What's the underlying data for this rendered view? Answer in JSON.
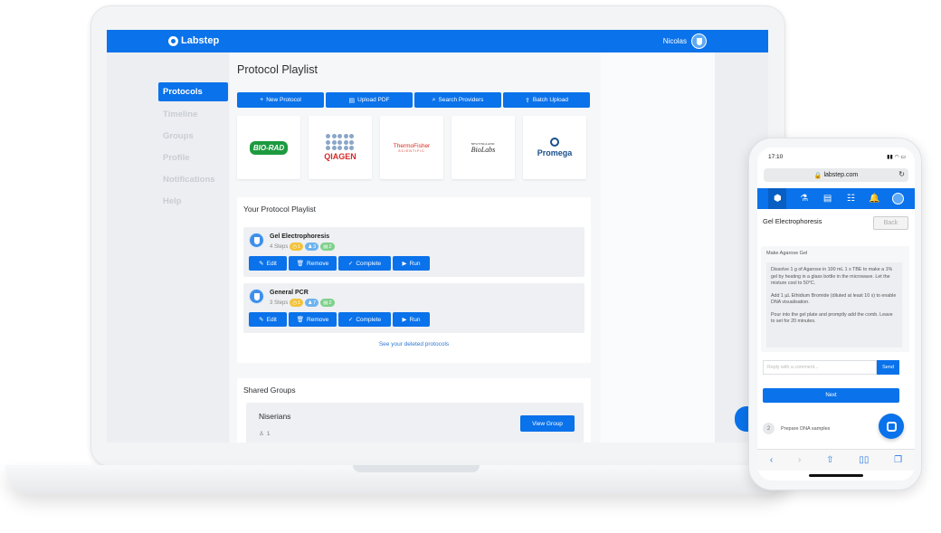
{
  "app": {
    "logo": "Labstep",
    "user_name": "Nicolas"
  },
  "sidebar": {
    "items": [
      {
        "label": "Protocols",
        "active": true
      },
      {
        "label": "Timeline"
      },
      {
        "label": "Groups"
      },
      {
        "label": "Profile"
      },
      {
        "label": "Notifications"
      },
      {
        "label": "Help"
      }
    ]
  },
  "main": {
    "title": "Protocol Playlist",
    "actions": [
      "New Protocol",
      "Upload PDF",
      "Search Providers",
      "Batch Upload"
    ],
    "providers": [
      "BIO-RAD",
      "QIAGEN",
      "ThermoFisher",
      "SCIENTIFIC",
      "NEW ENGLAND",
      "BioLabs",
      "Promega"
    ],
    "playlist": {
      "title": "Your Protocol Playlist",
      "protocols": [
        {
          "name": "Gel Electrophoresis",
          "steps": "4 Steps",
          "badges": [
            "1",
            "3",
            "2"
          ]
        },
        {
          "name": "General PCR",
          "steps": "3 Steps",
          "badges": [
            "1",
            "7",
            "2"
          ]
        }
      ],
      "item_actions": [
        "Edit",
        "Remove",
        "Complete",
        "Run"
      ],
      "deleted_link": "See your deleted protocols"
    },
    "shared": {
      "title": "Shared Groups",
      "group_name": "Niserians",
      "member_count": "1",
      "view_button": "View Group"
    }
  },
  "phone": {
    "time": "17:10",
    "url": "labstep.com",
    "title": "Gel Electrophoresis",
    "back": "Back",
    "step_title": "Make Agarose Gel",
    "step_paragraphs": [
      "Dissolve 1 g of Agarose in 100 mL 1 x TBE to make a 1% gel by heating in a glass bottle in the microwave. Let the mixture cool to 50°C.",
      "Add 1 µL Ethidium Bromide (diluted at least 10 x) to enable DNA visualisation.",
      "Pour into the gel plate and promptly add the comb. Leave to set for 20 minutes."
    ],
    "comment_placeholder": "Reply with a comment...",
    "send": "Send",
    "next": "Next",
    "next_step_number": "2",
    "next_step_label": "Prepare DNA samples"
  },
  "colors": {
    "primary": "#0a72ea",
    "sidebar": "#eceef1"
  }
}
